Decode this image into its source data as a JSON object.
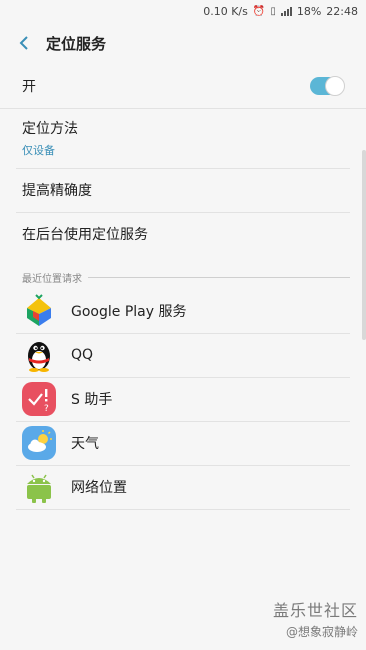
{
  "status_bar": {
    "speed": "0.10 K/s",
    "battery": "18%",
    "time": "22:48"
  },
  "header": {
    "title": "定位服务"
  },
  "toggle_row": {
    "label": "开",
    "state": "on"
  },
  "settings": [
    {
      "label": "定位方法",
      "sub": "仅设备"
    },
    {
      "label": "提高精确度"
    },
    {
      "label": "在后台使用定位服务"
    }
  ],
  "recent_section": {
    "title": "最近位置请求",
    "apps": [
      {
        "label": "Google Play 服务",
        "icon": "google-play-services-icon"
      },
      {
        "label": "QQ",
        "icon": "qq-penguin-icon"
      },
      {
        "label": "S 助手",
        "icon": "s-assistant-icon"
      },
      {
        "label": "天气",
        "icon": "weather-icon"
      },
      {
        "label": "网络位置",
        "icon": "android-icon"
      }
    ]
  },
  "watermark": {
    "line1": "盖乐世社区",
    "line2": "@想象寂静岭"
  },
  "colors": {
    "accent": "#3a8fb7",
    "toggle_on": "#5bb6d6"
  }
}
